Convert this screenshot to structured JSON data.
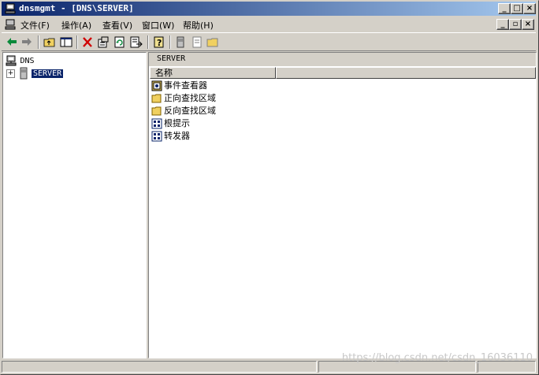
{
  "window": {
    "title": "dnsmgmt - [DNS\\SERVER]",
    "titlebar_colors": [
      "#0a246a",
      "#a6caf0"
    ]
  },
  "window_buttons": {
    "minimize": "_",
    "restore": "□",
    "close": "×"
  },
  "menu": {
    "items": [
      {
        "label": "文件(F)"
      },
      {
        "label": "操作(A)"
      },
      {
        "label": "查看(V)"
      },
      {
        "label": "窗口(W)"
      },
      {
        "label": "帮助(H)"
      }
    ]
  },
  "toolbar": {
    "icons": [
      "back-arrow-icon",
      "forward-arrow-icon",
      "up-folder-icon",
      "show-hide-tree-icon",
      "delete-icon",
      "properties-icon",
      "refresh-icon",
      "export-list-icon",
      "help-icon",
      "server-icon",
      "document-icon",
      "folder-icon"
    ]
  },
  "tree": {
    "root": "DNS",
    "server": "SERVER",
    "expander": "+"
  },
  "details": {
    "header": "SERVER",
    "column": "名称",
    "items": [
      {
        "label": "事件查看器",
        "icon": "event-viewer-icon"
      },
      {
        "label": "正向查找区域",
        "icon": "folder-icon"
      },
      {
        "label": "反向查找区域",
        "icon": "folder-icon"
      },
      {
        "label": "根提示",
        "icon": "root-hints-icon"
      },
      {
        "label": "转发器",
        "icon": "forwarders-icon"
      }
    ]
  },
  "watermark": "https://blog.csdn.net/csdn_16036110"
}
